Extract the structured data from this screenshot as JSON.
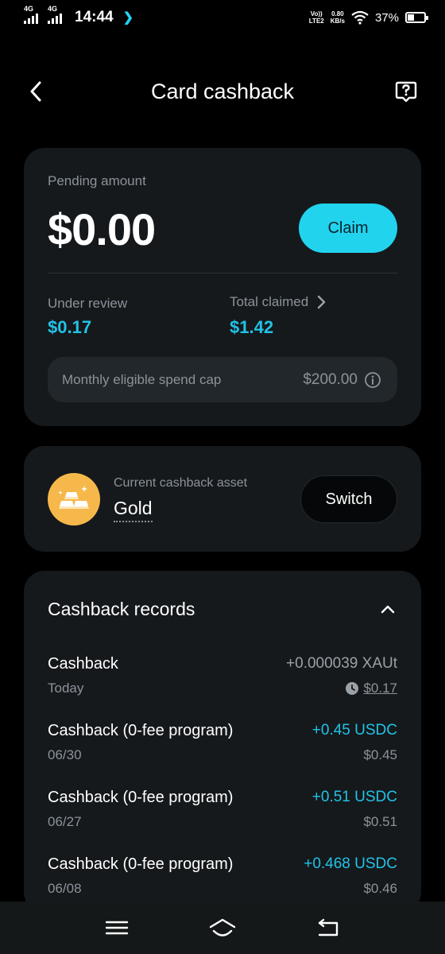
{
  "status_bar": {
    "sim1": "4G",
    "sim2": "4G",
    "time": "14:44",
    "net_top": "Vo))",
    "net_bottom": "LTE2",
    "speed_top": "0.80",
    "speed_bottom": "KB/s",
    "battery": "37%"
  },
  "header": {
    "title": "Card cashback",
    "back_icon": "chevron-left-icon",
    "help_icon": "help-icon"
  },
  "pending": {
    "label": "Pending amount",
    "amount": "$0.00",
    "claim_label": "Claim",
    "under_review_label": "Under review",
    "under_review_value": "$0.17",
    "total_claimed_label": "Total claimed",
    "total_claimed_value": "$1.42",
    "cap_label": "Monthly eligible spend cap",
    "cap_value": "$200.00"
  },
  "asset": {
    "label": "Current cashback asset",
    "value": "Gold",
    "switch_label": "Switch",
    "icon": "gold-bars-icon"
  },
  "records": {
    "title": "Cashback records",
    "items": [
      {
        "name": "Cashback",
        "date": "Today",
        "amount": "+0.000039 XAUt",
        "usd": "$0.17"
      },
      {
        "name": "Cashback (0-fee program)",
        "date": "06/30",
        "amount": "+0.45 USDC",
        "usd": "$0.45"
      },
      {
        "name": "Cashback (0-fee program)",
        "date": "06/27",
        "amount": "+0.51 USDC",
        "usd": "$0.51"
      },
      {
        "name": "Cashback (0-fee program)",
        "date": "06/08",
        "amount": "+0.468 USDC",
        "usd": "$0.46"
      }
    ]
  },
  "colors": {
    "accent": "#22d3ee",
    "card_bg": "#15191c",
    "gold": "#f7b84b"
  }
}
